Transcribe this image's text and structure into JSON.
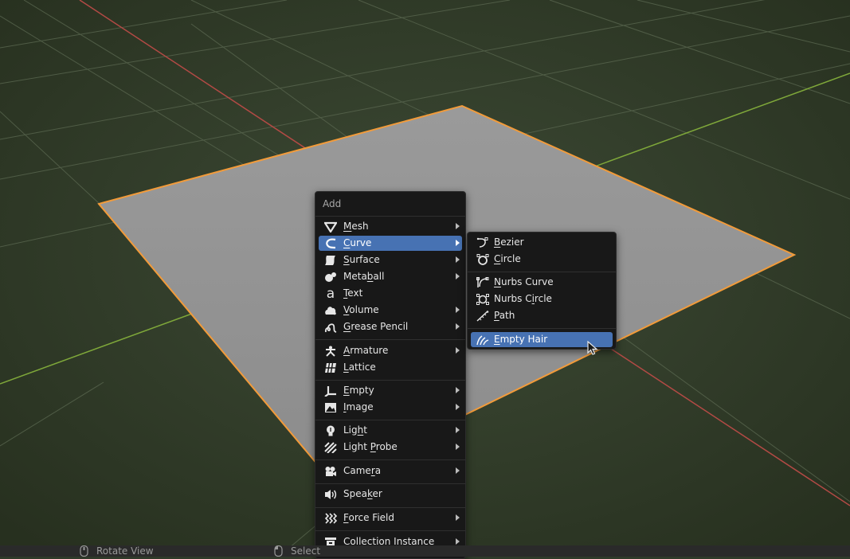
{
  "add_menu": {
    "title": "Add",
    "items": [
      {
        "pre": "",
        "u": "M",
        "post": "esh",
        "icon": "mesh-icon"
      },
      {
        "pre": "",
        "u": "C",
        "post": "urve",
        "icon": "curve-icon"
      },
      {
        "pre": "",
        "u": "S",
        "post": "urface",
        "icon": "surface-icon"
      },
      {
        "pre": "Meta",
        "u": "b",
        "post": "all",
        "icon": "metaball-icon"
      },
      {
        "pre": "",
        "u": "T",
        "post": "ext",
        "icon": "text-icon"
      },
      {
        "pre": "",
        "u": "V",
        "post": "olume",
        "icon": "volume-icon"
      },
      {
        "pre": "",
        "u": "G",
        "post": "rease Pencil",
        "icon": "grease-pencil-icon"
      },
      {
        "pre": "",
        "u": "A",
        "post": "rmature",
        "icon": "armature-icon"
      },
      {
        "pre": "",
        "u": "L",
        "post": "attice",
        "icon": "lattice-icon"
      },
      {
        "pre": "",
        "u": "E",
        "post": "mpty",
        "icon": "empty-icon"
      },
      {
        "pre": "",
        "u": "I",
        "post": "mage",
        "icon": "image-icon"
      },
      {
        "pre": "Lig",
        "u": "h",
        "post": "t",
        "icon": "light-icon"
      },
      {
        "pre": "Light ",
        "u": "P",
        "post": "robe",
        "icon": "light-probe-icon"
      },
      {
        "pre": "Came",
        "u": "r",
        "post": "a",
        "icon": "camera-icon"
      },
      {
        "pre": "Spea",
        "u": "k",
        "post": "er",
        "icon": "speaker-icon"
      },
      {
        "pre": "",
        "u": "F",
        "post": "orce Field",
        "icon": "force-field-icon"
      },
      {
        "pre": "",
        "u": "C",
        "post": "ollection Instance",
        "icon": "collection-instance-icon"
      }
    ]
  },
  "curve_menu": {
    "items": [
      {
        "pre": "",
        "u": "B",
        "post": "ezier",
        "icon": "bezier-icon"
      },
      {
        "pre": "",
        "u": "C",
        "post": "ircle",
        "icon": "circle-icon"
      },
      {
        "pre": "",
        "u": "N",
        "post": "urbs Curve",
        "icon": "nurbs-curve-icon"
      },
      {
        "pre": "Nurbs C",
        "u": "i",
        "post": "rcle",
        "icon": "nurbs-circle-icon"
      },
      {
        "pre": "",
        "u": "P",
        "post": "ath",
        "icon": "path-icon"
      },
      {
        "pre": "",
        "u": "E",
        "post": "mpty Hair",
        "icon": "empty-hair-icon"
      }
    ]
  },
  "status_bar": {
    "rotate_view": "Rotate View",
    "select": "Select"
  },
  "colors": {
    "highlight": "#4772b3",
    "menu_bg": "#181818",
    "selection_outline": "#f29b3a",
    "x_axis": "#b34a45",
    "y_axis": "#7fa83a"
  }
}
